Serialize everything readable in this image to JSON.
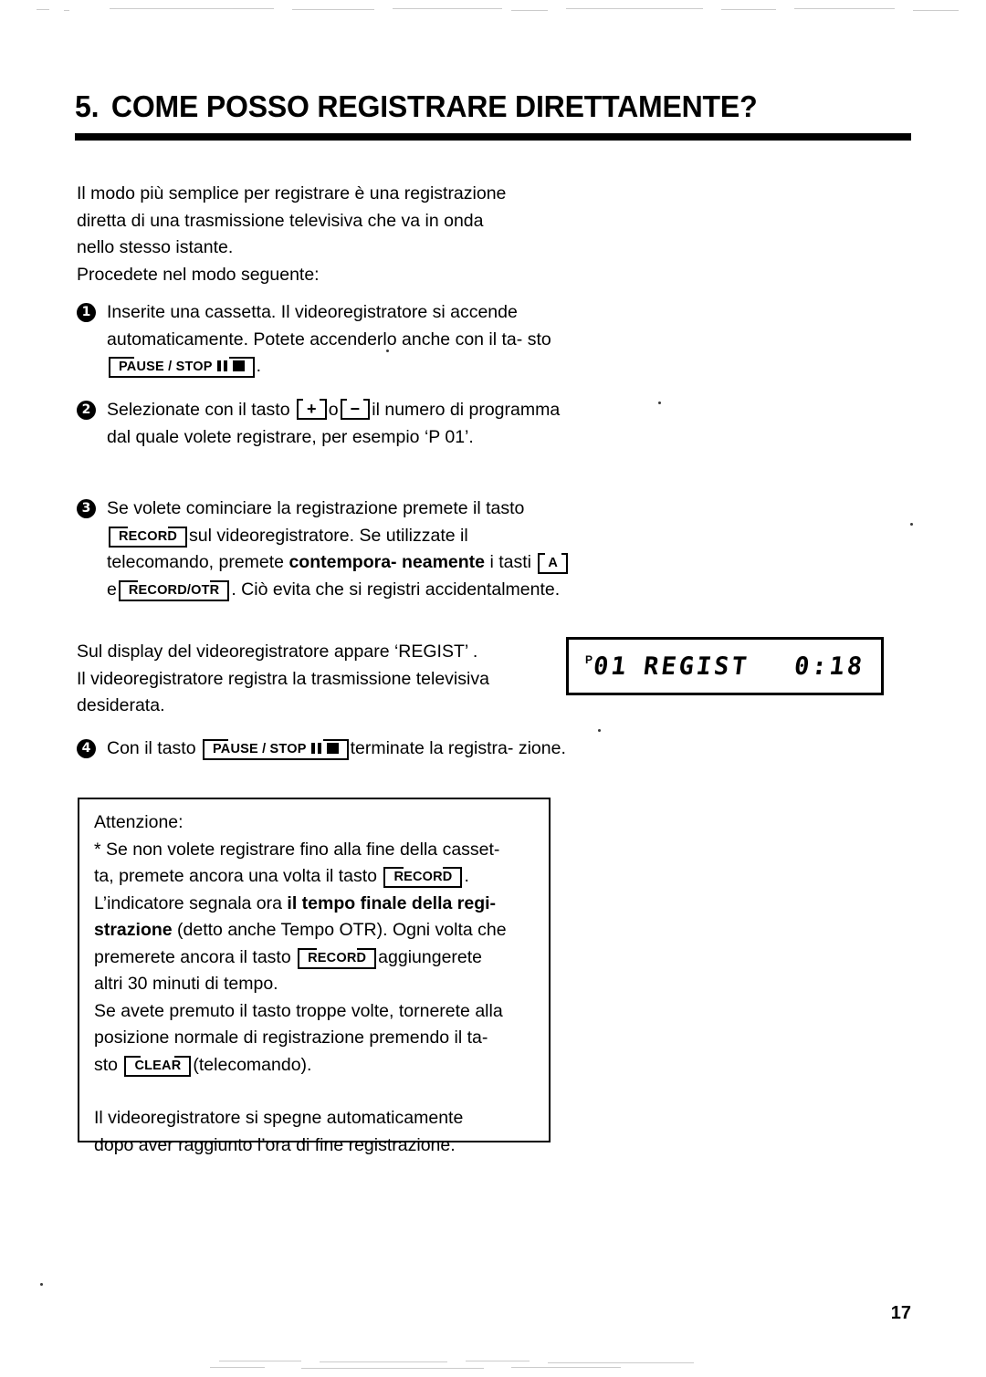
{
  "page": {
    "number": "17",
    "language": "it"
  },
  "heading": {
    "number": "5.",
    "title": "COME POSSO REGISTRARE DIRETTAMENTE?"
  },
  "intro": {
    "line1": "Il modo più semplice per registrare è una registrazione",
    "line2": "diretta di una trasmissione televisiva che va in onda",
    "line3": "nello stesso istante.",
    "line4": "Procedete nel modo seguente:"
  },
  "steps": [
    {
      "number": "❶",
      "marker": "1",
      "text_a": "Inserite una cassetta. Il videoregistratore si accende automaticamente. Potete accenderlo anche con il ta-",
      "text_b": "sto",
      "button": "PAUSE / STOP",
      "text_c": "."
    },
    {
      "number": "❷",
      "marker": "2",
      "text_a": "Selezionate con il tasto",
      "button_plus": "+",
      "text_b": "o",
      "button_minus": "−",
      "text_c": "il numero di programma dal quale volete registrare, per esempio",
      "text_d": "‘P 01’."
    },
    {
      "number": "❸",
      "marker": "3",
      "text_a": "Se volete cominciare la registrazione premete il tasto",
      "button_record": "RECORD",
      "text_b": "sul videoregistratore.",
      "text_c": "Se utilizzate il telecomando, premete",
      "bold_a": "contempora-",
      "bold_b": "neamente",
      "text_d": "i tasti",
      "button_a": "A",
      "text_e": "e",
      "button_record_otr": "RECORD/OTR",
      "text_f": ". Ciò evita che si registri accidentalmente."
    },
    {
      "number": "❹",
      "marker": "4",
      "text_a": "Con il tasto",
      "button": "PAUSE / STOP",
      "text_b": "terminate la registra-",
      "text_c": "zione."
    }
  ],
  "after_steps": {
    "line1": "Sul display del videoregistratore appare ‘REGIST’ .",
    "line2": "Il videoregistratore registra la trasmissione televisiva",
    "line3": "desiderata."
  },
  "vcr_display": {
    "program_indicator": "P",
    "program_number": "01",
    "mode": "REGIST",
    "time": "0:18"
  },
  "note_box": {
    "title": "Attenzione:",
    "para1_a": "* Se non volete registrare fino alla fine della casset-",
    "para1_b": "ta, premete ancora una volta il tasto",
    "para1_button": "RECORD",
    "para1_c": ".",
    "para2_a": "L’indicatore segnala ora",
    "para2_bold_a": "il tempo finale della regi-",
    "para2_bold_b": "strazione",
    "para2_b": "(detto anche Tempo OTR). Ogni volta che",
    "para2_c": "premerete ancora il tasto",
    "para2_button": "RECORD",
    "para2_d": "aggiungerete",
    "para2_e": "altri 30 minuti di tempo.",
    "para3_a": "Se avete premuto il tasto troppe volte, tornerete alla",
    "para3_b": "posizione normale di registrazione premendo il ta-",
    "para3_c": "sto",
    "para3_button": "CLEAR",
    "para3_d": "(telecomando).",
    "para4_a": "Il videoregistratore si spegne automaticamente",
    "para4_b": "dopo aver raggiunto l’ora di fine registrazione."
  },
  "colors": {
    "ink": "#000000",
    "paper": "#ffffff"
  }
}
